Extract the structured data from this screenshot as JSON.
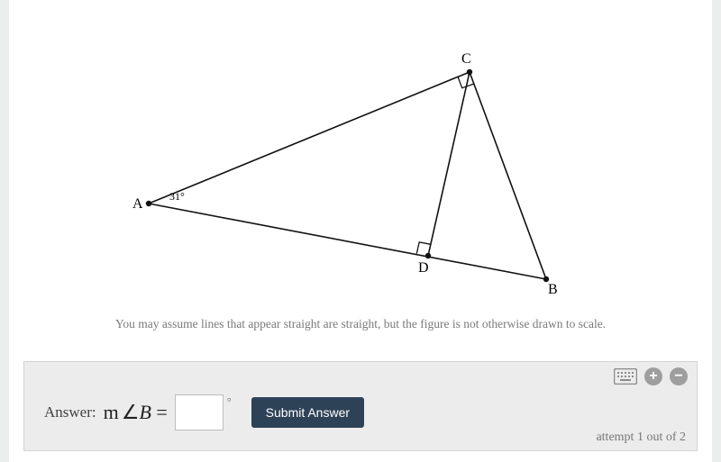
{
  "figure": {
    "hint_text": "You may assume lines that appear straight are straight, but the figure is not otherwise drawn to scale.",
    "angle_at_A": "31°",
    "vertices": {
      "A": "A",
      "B": "B",
      "C": "C",
      "D": "D"
    }
  },
  "answer_panel": {
    "label": "Answer:",
    "math_expr": {
      "prefix": "m",
      "angle_sym": "∠",
      "var": "B",
      "equals": "="
    },
    "input_value": "",
    "degree_symbol": "°",
    "submit_label": "Submit Answer",
    "attempt_text": "attempt 1 out of 2"
  }
}
